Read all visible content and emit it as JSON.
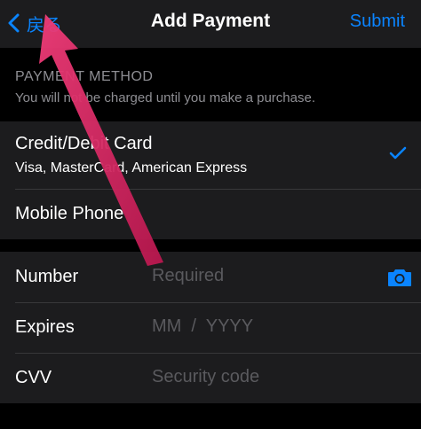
{
  "nav": {
    "back_label": "戻る",
    "title": "Add Payment",
    "submit_label": "Submit"
  },
  "section": {
    "title": "PAYMENT METHOD",
    "subtitle": "You will not be charged until you make a purchase."
  },
  "methods": [
    {
      "title": "Credit/Debit Card",
      "subtitle": "Visa, MasterCard, American Express",
      "selected": true
    },
    {
      "title": "Mobile Phone",
      "subtitle": "",
      "selected": false
    }
  ],
  "fields": {
    "number": {
      "label": "Number",
      "placeholder": "Required"
    },
    "expires": {
      "label": "Expires",
      "placeholder": "MM  /  YYYY"
    },
    "cvv": {
      "label": "CVV",
      "placeholder": "Security code"
    }
  },
  "colors": {
    "accent": "#0a84ff",
    "annotation_arrow": "#e8326e"
  },
  "icons": [
    "chevron-left-icon",
    "checkmark-icon",
    "camera-icon"
  ]
}
